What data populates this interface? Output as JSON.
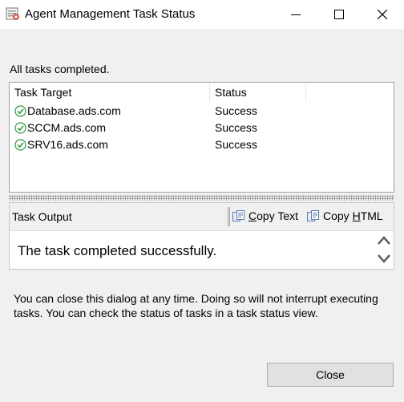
{
  "window": {
    "title": "Agent Management Task Status"
  },
  "summary": "All tasks completed.",
  "task_list": {
    "columns": [
      "Task Target",
      "Status"
    ],
    "rows": [
      {
        "target": "Database.ads.com",
        "status": "Success",
        "icon": "success-check-icon"
      },
      {
        "target": "SCCM.ads.com",
        "status": "Success",
        "icon": "success-check-icon"
      },
      {
        "target": "SRV16.ads.com",
        "status": "Success",
        "icon": "success-check-icon"
      }
    ]
  },
  "output": {
    "title": "Task Output",
    "copy_text_pre": "",
    "copy_text_access": "C",
    "copy_text_post": "opy Text",
    "copy_html_pre": "Copy ",
    "copy_html_access": "H",
    "copy_html_post": "TML",
    "message": "The task completed successfully."
  },
  "info": "You can close this dialog at any time. Doing so will not interrupt executing tasks. You can check the status of tasks in a task status view.",
  "buttons": {
    "close": "Close"
  },
  "colors": {
    "success": "#2e9b3a",
    "accent": "#0078d7"
  }
}
